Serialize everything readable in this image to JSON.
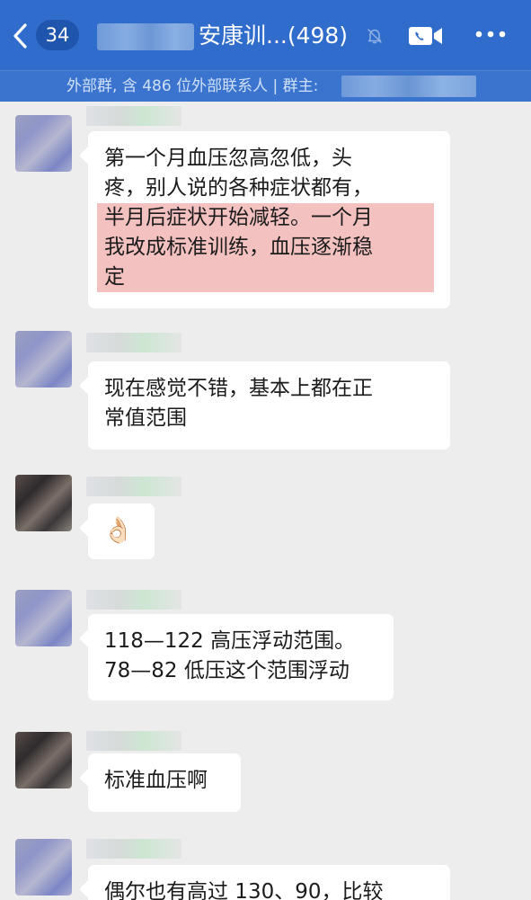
{
  "header": {
    "unread_count": "34",
    "title": "安康训...(498)",
    "subtitle": "外部群, 含 486 位外部联系人 | 群主:",
    "bg_color": "#2f6ccb"
  },
  "icons": [
    "back-icon",
    "mute-icon",
    "video-call-icon",
    "more-icon"
  ],
  "messages": [
    {
      "lines": [
        "第一个月血压忽高忽低，头",
        "疼，别人说的各种症状都有，"
      ],
      "highlight": [
        "半月后症状开始减轻。一个月",
        "我改成标准训练，血压逐渐稳",
        "定"
      ]
    },
    {
      "lines": [
        "现在感觉不错，基本上都在正",
        "常值范围"
      ]
    },
    {
      "emoji": "👌🏻"
    },
    {
      "lines": [
        "118—122 高压浮动范围。",
        "78—82 低压这个范围浮动"
      ]
    },
    {
      "lines": [
        "标准血压啊"
      ]
    },
    {
      "lines": [
        "偶尔也有高过 130、90，比较"
      ]
    }
  ]
}
